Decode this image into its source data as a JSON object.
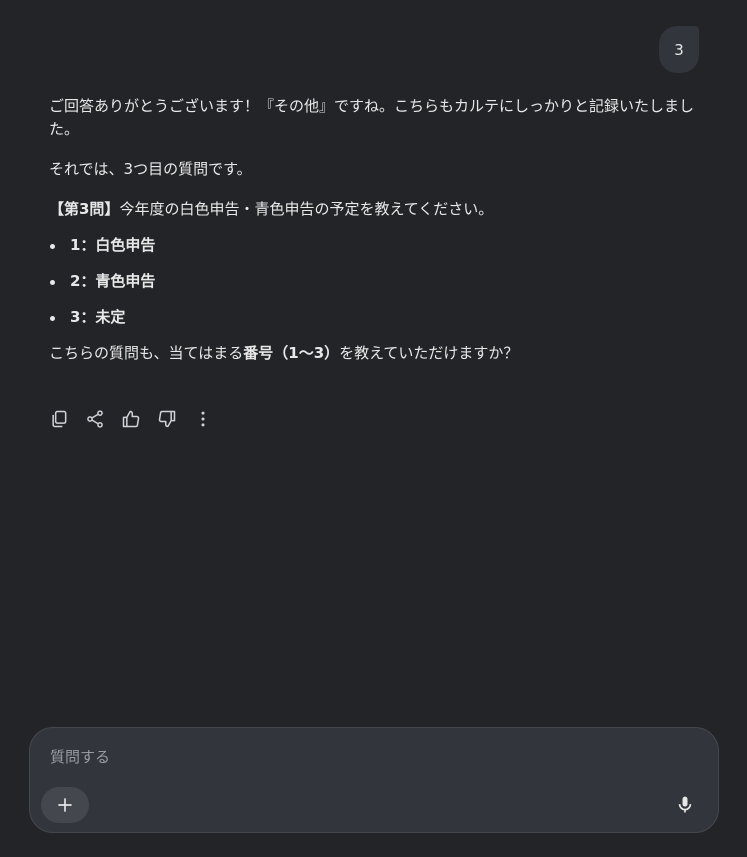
{
  "user_message": {
    "text": "3"
  },
  "response": {
    "p1": "ご回答ありがとうございます！『その他』ですね。こちらもカルテにしっかりと記録いたしました。",
    "p2": "それでは、3つ目の質問です。",
    "p3_bold": "【第3問】",
    "p3_rest": "今年度の白色申告・青色申告の予定を教えてください。",
    "options": [
      "1：白色申告",
      "2：青色申告",
      "3：未定"
    ],
    "p4_start": "こちらの質問も、当てはまる",
    "p4_bold": "番号（1〜3）",
    "p4_end": "を教えていただけますか？"
  },
  "actions": {
    "icons": [
      "copy-icon",
      "share-icon",
      "thumbs-up-icon",
      "thumbs-down-icon",
      "more-vert-icon"
    ]
  },
  "composer": {
    "placeholder": "質問する"
  },
  "colors": {
    "background": "#232428",
    "surface": "#33353c",
    "text": "#e8e8e8",
    "muted": "#9a9ca3"
  }
}
